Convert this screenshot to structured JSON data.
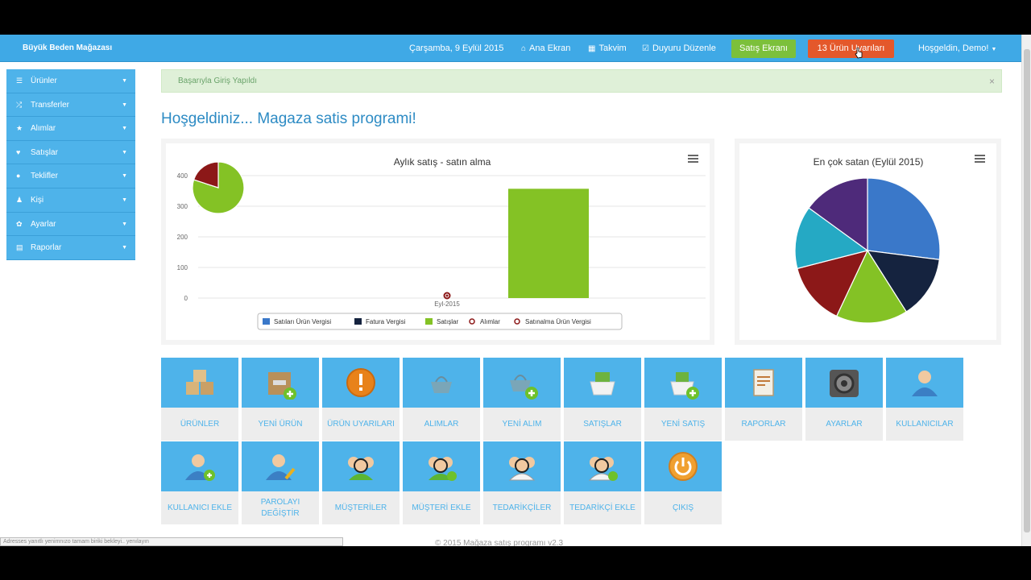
{
  "topnav": {
    "brand": "Büyük Beden Mağazası",
    "date": "Çarşamba, 9 Eylül 2015",
    "home": "Ana Ekran",
    "calendar": "Takvim",
    "announce": "Duyuru Düzenle",
    "sales_screen": "Satış Ekranı",
    "warnings": "13 Ürün Uyarıları",
    "user": "Hoşgeldin, Demo!"
  },
  "sidebar": {
    "items": [
      {
        "label": "Ürünler",
        "icon": "list-icon"
      },
      {
        "label": "Transferler",
        "icon": "shuffle-icon"
      },
      {
        "label": "Alımlar",
        "icon": "star-icon"
      },
      {
        "label": "Satışlar",
        "icon": "heart-icon"
      },
      {
        "label": "Teklifler",
        "icon": "info-icon"
      },
      {
        "label": "Kişi",
        "icon": "user-icon"
      },
      {
        "label": "Ayarlar",
        "icon": "gear-icon"
      },
      {
        "label": "Raporlar",
        "icon": "table-icon"
      }
    ]
  },
  "alert": {
    "text": "Başarıyla Giriş Yapıldı",
    "close": "×"
  },
  "page_title": "Hoşgeldiniz... Magaza satis programi!",
  "chart_data": [
    {
      "type": "bar",
      "title": "Aylık satış - satın alma",
      "categories": [
        "Eyl-2015"
      ],
      "yticks": [
        "400",
        "300",
        "200",
        "100",
        "0"
      ],
      "ylim": [
        0,
        400
      ],
      "series": [
        {
          "name": "Satıları Ürün Vergisi",
          "color": "#3a78c9",
          "values": [
            0
          ]
        },
        {
          "name": "Fatura Vergisi",
          "color": "#15233f",
          "values": [
            0
          ]
        },
        {
          "name": "Satışlar",
          "color": "#84c225",
          "values": [
            357
          ]
        },
        {
          "name": "Alımlar",
          "color": "#8c1818",
          "values": [
            0
          ]
        },
        {
          "name": "Satınalma Ürün Vergisi",
          "color": "#8c1818",
          "values": [
            0
          ]
        }
      ],
      "inset_pie": [
        {
          "color": "#84c225",
          "value": 80
        },
        {
          "color": "#8c1818",
          "value": 20
        }
      ],
      "legend_position": "bottom"
    },
    {
      "type": "pie",
      "title": "En çok satan (Eylül 2015)",
      "slices": [
        {
          "color": "#3a78c9",
          "value": 27
        },
        {
          "color": "#15233f",
          "value": 14
        },
        {
          "color": "#84c225",
          "value": 16
        },
        {
          "color": "#8c1818",
          "value": 14
        },
        {
          "color": "#25a9c4",
          "value": 14
        },
        {
          "color": "#4e2a7a",
          "value": 15
        }
      ]
    }
  ],
  "tiles": [
    {
      "label": "ÜRÜNLER",
      "icon": "boxes-icon"
    },
    {
      "label": "YENİ ÜRÜN",
      "icon": "new-product-icon"
    },
    {
      "label": "ÜRÜN UYARILARI",
      "icon": "warning-icon"
    },
    {
      "label": "ALIMLAR",
      "icon": "basket-icon"
    },
    {
      "label": "YENİ ALIM",
      "icon": "new-basket-icon"
    },
    {
      "label": "SATIŞLAR",
      "icon": "cash-box-icon"
    },
    {
      "label": "YENİ SATIŞ",
      "icon": "new-cash-box-icon"
    },
    {
      "label": "RAPORLAR",
      "icon": "report-icon"
    },
    {
      "label": "AYARLAR",
      "icon": "gears-icon"
    },
    {
      "label": "KULLANICILAR",
      "icon": "user-icon"
    },
    {
      "label": "KULLANICI EKLE",
      "icon": "add-user-icon"
    },
    {
      "label": "PAROLAYI DEĞİŞTİR",
      "icon": "edit-user-icon"
    },
    {
      "label": "MÜŞTERİLER",
      "icon": "customers-icon"
    },
    {
      "label": "MÜŞTERİ EKLE",
      "icon": "add-customer-icon"
    },
    {
      "label": "TEDARİKÇİLER",
      "icon": "suppliers-icon"
    },
    {
      "label": "TEDARİKÇİ EKLE",
      "icon": "add-supplier-icon"
    },
    {
      "label": "ÇIKIŞ",
      "icon": "power-icon"
    }
  ],
  "footer": "© 2015 Mağaza satış programı v2.3",
  "statusbar": "Adresses yanıtlı yenimnızo tamam biriki bekleyi.. yenılayın"
}
